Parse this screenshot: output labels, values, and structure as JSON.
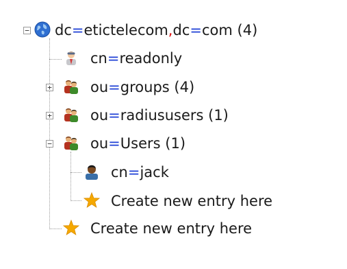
{
  "tree": {
    "root": {
      "label_parts": [
        "dc",
        "=",
        "etictelecom",
        ",",
        "dc",
        "=",
        "com",
        " (4)"
      ]
    },
    "readonly": {
      "attr": "cn",
      "eq": "=",
      "value": "readonly"
    },
    "groups": {
      "attr": "ou",
      "eq": "=",
      "value": "groups",
      "count": " (4)"
    },
    "radiususers": {
      "attr": "ou",
      "eq": "=",
      "value": "radiususers",
      "count": " (1)"
    },
    "users": {
      "attr": "ou",
      "eq": "=",
      "value": "Users",
      "count": " (1)"
    },
    "jack": {
      "attr": "cn",
      "eq": "=",
      "value": "jack"
    },
    "create_child": "Create new entry here",
    "create_root": "Create new entry here",
    "toggle_collapse": "−",
    "toggle_expand": "+"
  },
  "colors": {
    "equals": "#1d3fd6",
    "comma": "#e01010",
    "star": "#f5a800",
    "tree_lines": "#9a9a9a"
  },
  "icons": [
    "globe-icon",
    "user-icon",
    "group-icon",
    "person-icon",
    "star-icon"
  ]
}
